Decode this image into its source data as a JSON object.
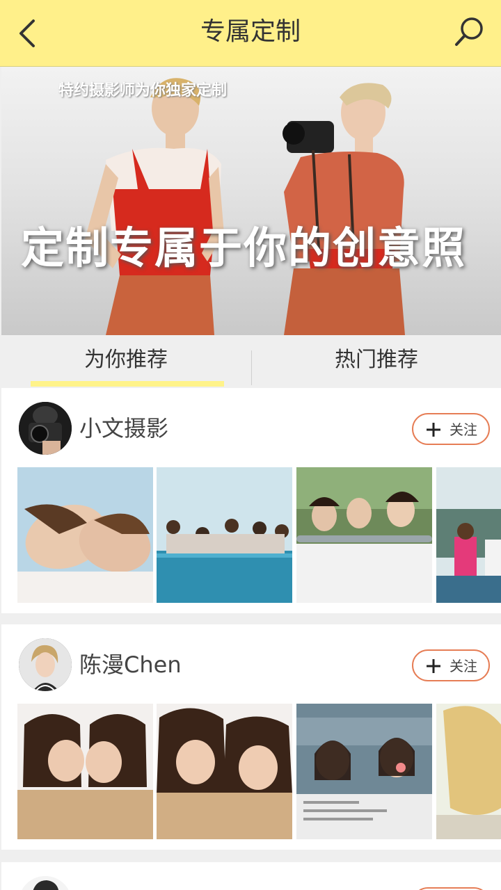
{
  "header": {
    "title": "专属定制",
    "back_icon": "chevron-left-icon",
    "search_icon": "search-icon"
  },
  "banner": {
    "subtitle": "特约摄影师为你独家定制",
    "headline": "定制专属于你的创意照"
  },
  "tabs": [
    {
      "label": "为你推荐",
      "active": true
    },
    {
      "label": "热门推荐",
      "active": false
    }
  ],
  "cards": [
    {
      "name": "小文摄影",
      "follow_label": "关注"
    },
    {
      "name": "陈漫Chen",
      "follow_label": "关注"
    },
    {
      "name": "",
      "follow_label": ""
    }
  ],
  "colors": {
    "header_bg": "#fff08a",
    "accent": "#e67d55",
    "tab_underline": "#fff38a"
  }
}
